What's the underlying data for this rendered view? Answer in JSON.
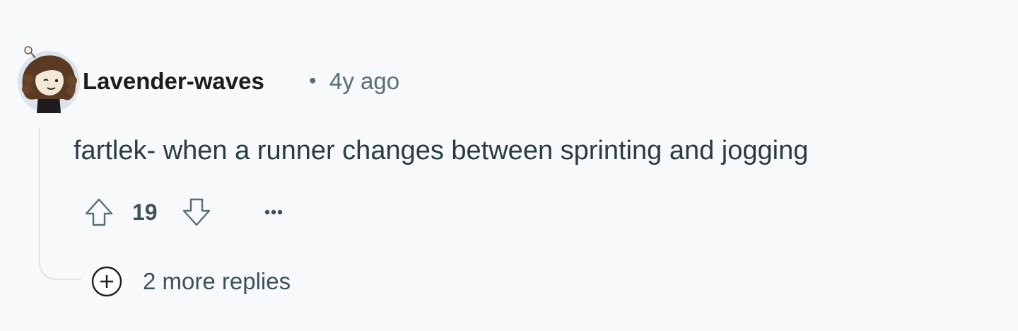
{
  "comment": {
    "author": "Lavender-waves",
    "separator": "•",
    "timestamp": "4y ago",
    "body": "fartlek- when a runner changes between sprinting and jogging",
    "score": "19",
    "more_replies_label": "2 more replies"
  },
  "icons": {
    "upvote": "upvote-arrow-icon",
    "downvote": "downvote-arrow-icon",
    "more": "ellipsis-icon",
    "expand": "plus-circle-icon"
  },
  "colors": {
    "background": "#f8f9fb",
    "username": "#1c1c1c",
    "meta": "#576f76",
    "body": "#2a3c42",
    "thread_line": "#dfe3e6"
  }
}
